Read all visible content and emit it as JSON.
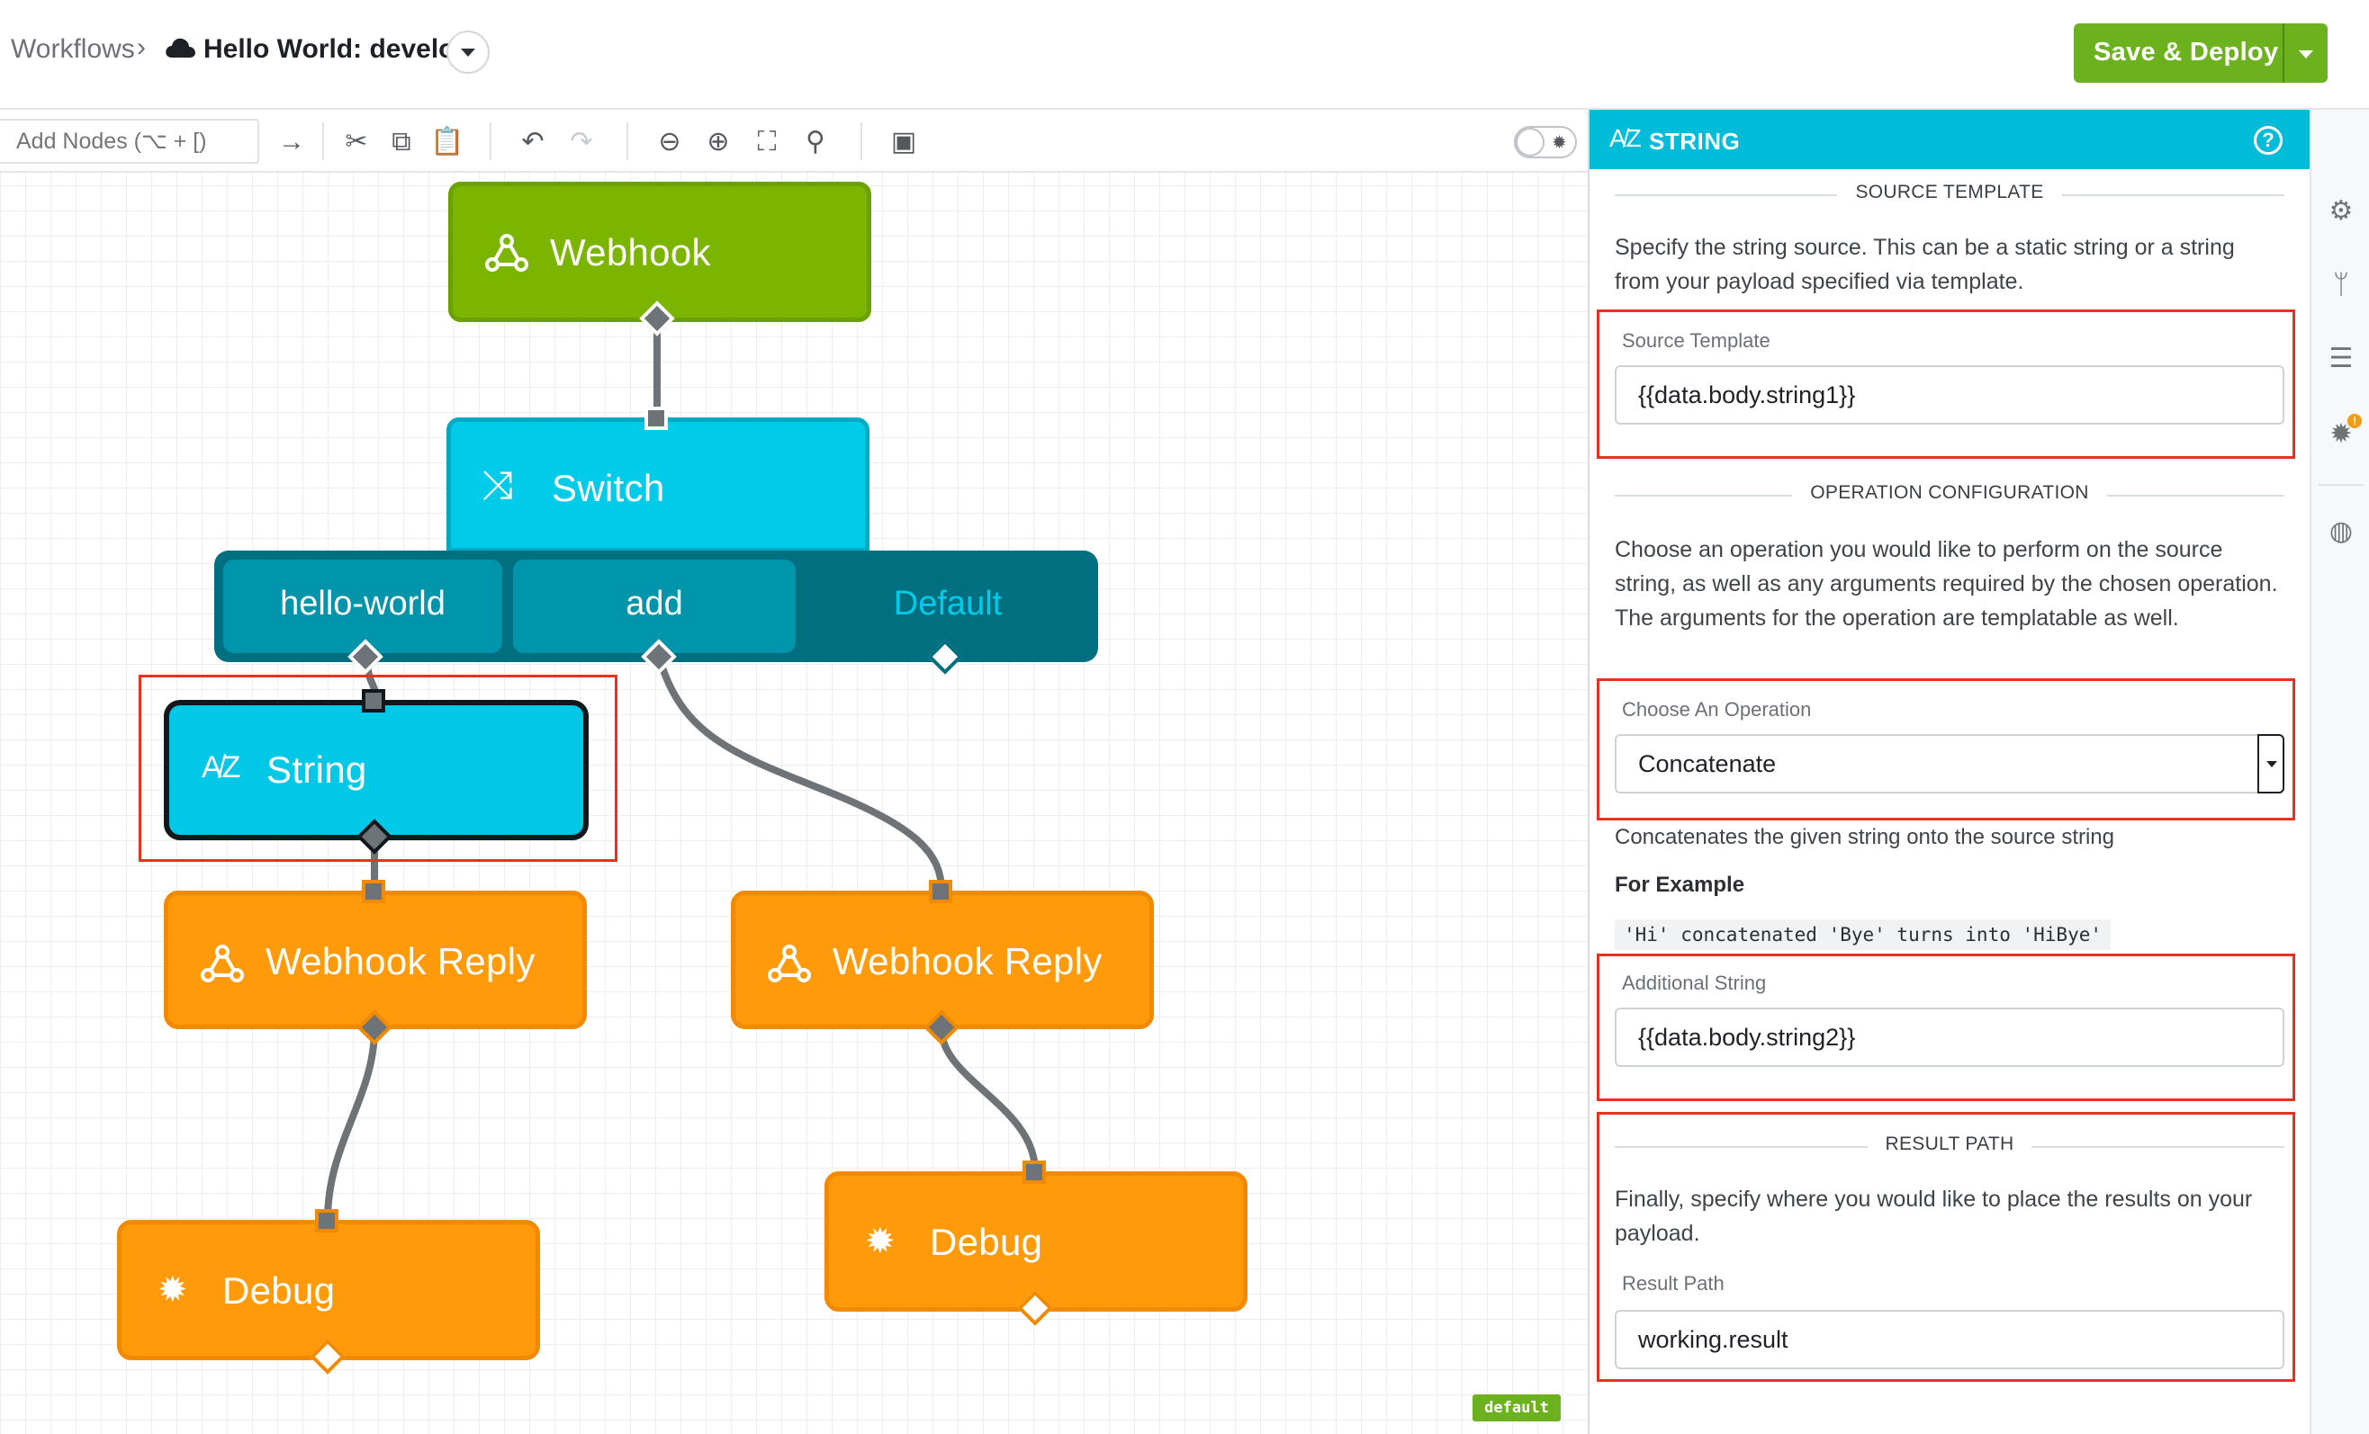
{
  "header": {
    "breadcrumb_root": "Workflows",
    "breadcrumb_sep": "›",
    "workflow_title": "Hello World: develop",
    "save_label": "Save & Deploy"
  },
  "toolbar": {
    "add_nodes_placeholder": "Add Nodes (⌥ + [)",
    "icons": [
      "arrow-right-icon",
      "scissors-icon",
      "copy-icon",
      "paste-icon",
      "undo-icon",
      "redo-icon",
      "zoom-out-icon",
      "zoom-in-icon",
      "fit-screen-icon",
      "search-icon",
      "comment-icon",
      "debug-toggle"
    ]
  },
  "nodes": {
    "webhook": "Webhook",
    "switch": "Switch",
    "switch_cases": [
      "hello-world",
      "add",
      "Default"
    ],
    "string": "String",
    "webhook_reply_left": "Webhook Reply",
    "webhook_reply_right": "Webhook Reply",
    "debug_left": "Debug",
    "debug_right": "Debug"
  },
  "canvas": {
    "version_tag": "default"
  },
  "panel": {
    "title": "STRING",
    "source_section": "SOURCE TEMPLATE",
    "source_desc": "Specify the string source. This can be a static string or a string from your payload specified via template.",
    "source_label": "Source Template",
    "source_value": "{{data.body.string1}}",
    "operation_section": "OPERATION CONFIGURATION",
    "operation_desc": "Choose an operation you would like to perform on the source string, as well as any arguments required by the chosen operation. The arguments for the operation are templatable as well.",
    "operation_label": "Choose An Operation",
    "operation_value": "Concatenate",
    "operation_help": "Concatenates the given string onto the source string",
    "example_heading": "For Example",
    "example_code": "'Hi' concatenated 'Bye' turns into 'HiBye'",
    "additional_label": "Additional String",
    "additional_value": "{{data.body.string2}}",
    "result_section": "RESULT PATH",
    "result_desc": "Finally, specify where you would like to place the results on your payload.",
    "result_label": "Result Path",
    "result_value": "working.result"
  },
  "colors": {
    "webhook": "#7cb500",
    "switch": "#00ccea",
    "switch_tabs": "#006f80",
    "string": "#00c8e6",
    "reply": "#ff9a0a",
    "debug": "#ff9a0a",
    "deploy": "#6cb21f",
    "highlight": "#e8321f"
  }
}
